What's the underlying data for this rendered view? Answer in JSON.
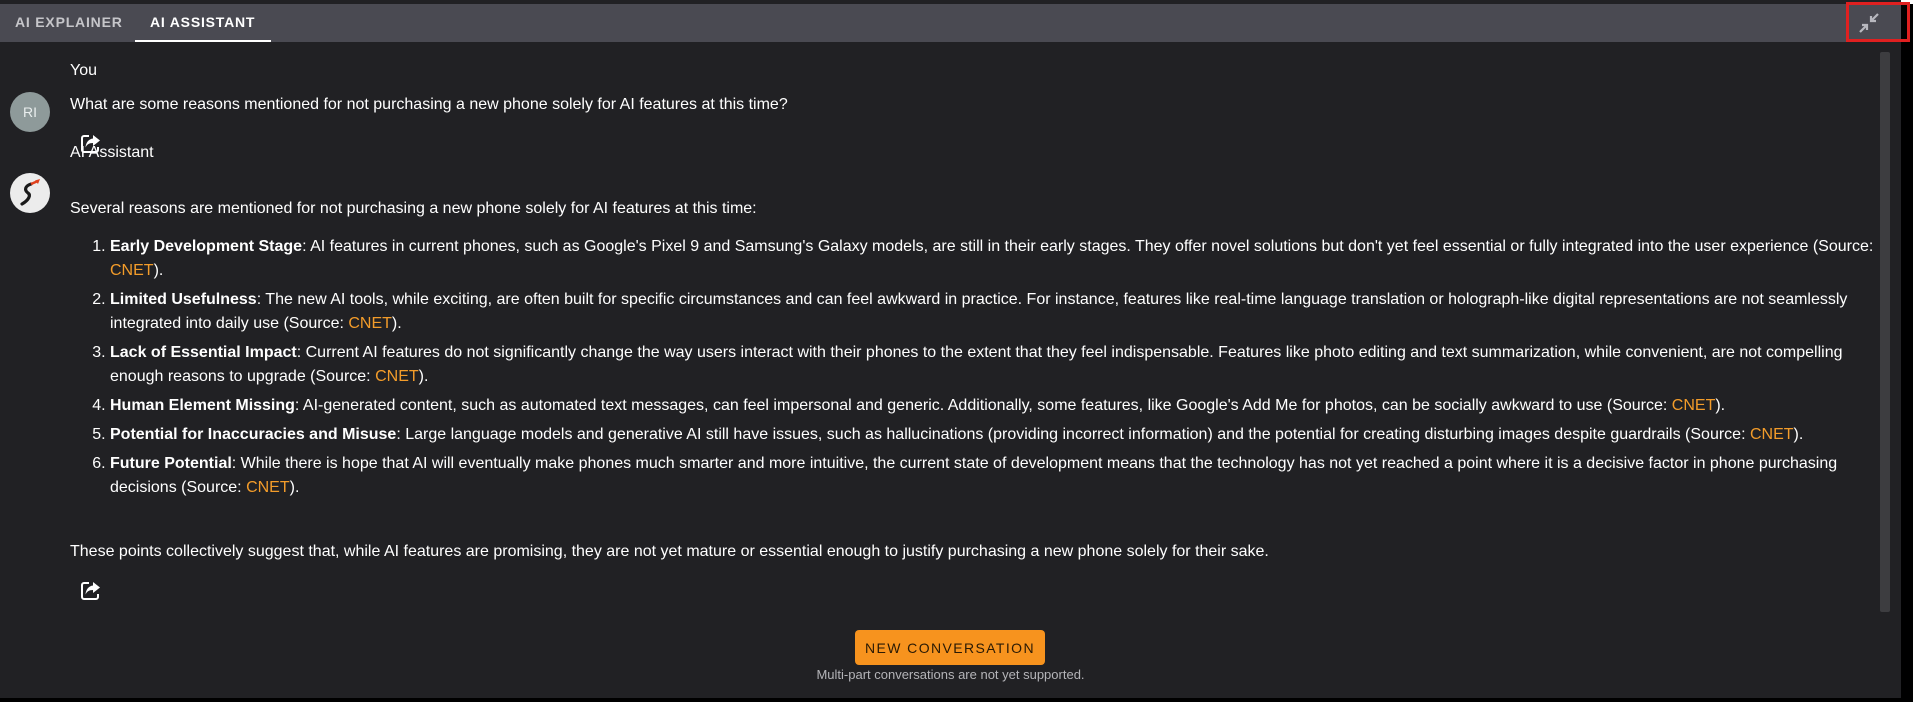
{
  "tabs": [
    {
      "label": "AI EXPLAINER",
      "active": false
    },
    {
      "label": "AI ASSISTANT",
      "active": true
    }
  ],
  "collapse_button": {
    "icon": "collapse-arrows-icon"
  },
  "conversation": {
    "user": {
      "avatar_initials": "RI",
      "sender": "You",
      "text": "What are some reasons mentioned for not purchasing a new phone solely for AI features at this time?",
      "share_icon": "share-icon"
    },
    "assistant": {
      "avatar_icon": "assistant-logo-icon",
      "sender": "AI Assistant",
      "intro": "Several reasons are mentioned for not purchasing a new phone solely for AI features at this time:",
      "reasons": [
        {
          "title": "Early Development Stage",
          "text": ": AI features in current phones, such as Google's Pixel 9 and Samsung's Galaxy models, are still in their early stages. They offer novel solutions but don't yet feel essential or fully integrated into the user experience (Source: ",
          "source": "CNET",
          "end": ")."
        },
        {
          "title": "Limited Usefulness",
          "text": ": The new AI tools, while exciting, are often built for specific circumstances and can feel awkward in practice. For instance, features like real-time language translation or holograph-like digital representations are not seamlessly integrated into daily use (Source: ",
          "source": "CNET",
          "end": ")."
        },
        {
          "title": "Lack of Essential Impact",
          "text": ": Current AI features do not significantly change the way users interact with their phones to the extent that they feel indispensable. Features like photo editing and text summarization, while convenient, are not compelling enough reasons to upgrade (Source: ",
          "source": "CNET",
          "end": ")."
        },
        {
          "title": "Human Element Missing",
          "text": ": AI-generated content, such as automated text messages, can feel impersonal and generic. Additionally, some features, like Google's Add Me for photos, can be socially awkward to use (Source: ",
          "source": "CNET",
          "end": ")."
        },
        {
          "title": "Potential for Inaccuracies and Misuse",
          "text": ": Large language models and generative AI still have issues, such as hallucinations (providing incorrect information) and the potential for creating disturbing images despite guardrails (Source: ",
          "source": "CNET",
          "end": ")."
        },
        {
          "title": "Future Potential",
          "text": ": While there is hope that AI will eventually make phones much smarter and more intuitive, the current state of development means that the technology has not yet reached a point where it is a decisive factor in phone purchasing decisions (Source: ",
          "source": "CNET",
          "end": ")."
        }
      ],
      "summary": "These points collectively suggest that, while AI features are promising, they are not yet mature or essential enough to justify purchasing a new phone solely for their sake.",
      "share_icon": "share-icon"
    }
  },
  "footer": {
    "new_conversation_label": "NEW CONVERSATION",
    "note": "Multi-part conversations are not yet supported."
  },
  "colors": {
    "accent": "#f7931e",
    "link": "#f39c2a",
    "background": "#212124",
    "tabbar": "#4a4a52"
  }
}
